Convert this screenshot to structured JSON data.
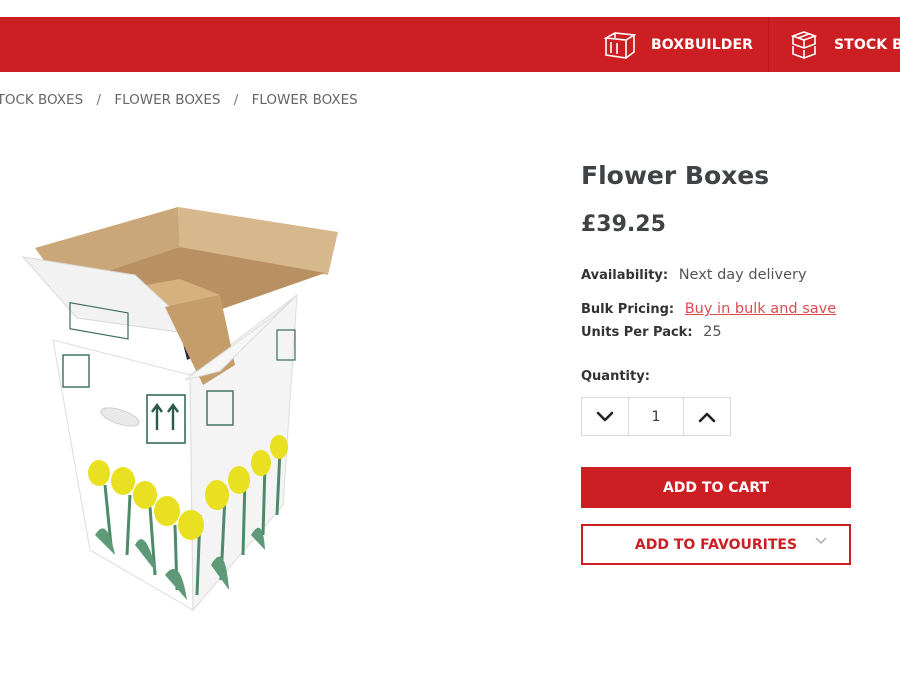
{
  "nav": {
    "items": [
      {
        "label": "BOXBUILDER",
        "icon": "box-outline-icon"
      },
      {
        "label": "STOCK BOXES",
        "icon": "stacked-boxes-icon"
      }
    ]
  },
  "breadcrumb": [
    "STOCK BOXES",
    "FLOWER BOXES",
    "FLOWER BOXES"
  ],
  "product": {
    "title": "Flower Boxes",
    "price": "£39.25",
    "availability_label": "Availability:",
    "availability_value": "Next day delivery",
    "bulk_label": "Bulk Pricing:",
    "bulk_link": "Buy in bulk and save",
    "units_label": "Units Per Pack:",
    "units_value": "25",
    "image": {
      "icon": "flower-box-product-image",
      "alt": "Flower Boxes"
    }
  },
  "quantity": {
    "label": "Quantity:",
    "value": "1"
  },
  "actions": {
    "add_to_cart": "ADD TO CART",
    "add_to_favourites": "ADD TO FAVOURITES"
  },
  "colors": {
    "brand_red": "#cc1f24",
    "link_red": "#dd4a4e",
    "title_dark": "#3f4346"
  }
}
